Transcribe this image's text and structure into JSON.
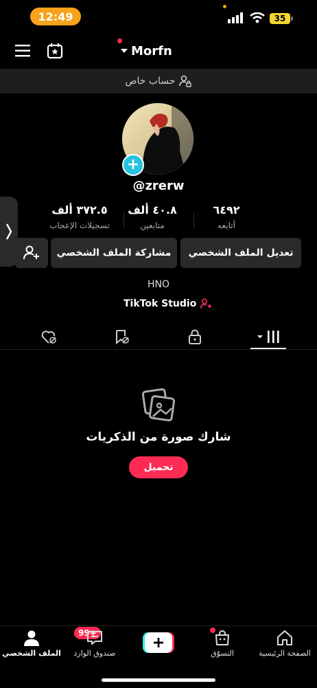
{
  "status_bar": {
    "time": "12:49",
    "battery": "35"
  },
  "header": {
    "username": "Morfn"
  },
  "private_account": {
    "label": "حساب خاص"
  },
  "profile": {
    "handle": "@zrerw",
    "bio": "HNO",
    "studio_link": "TikTok Studio"
  },
  "stats": {
    "following": {
      "value": "٦٤٩٢",
      "label": "أتابعه"
    },
    "followers": {
      "value": "٤٠.٨ ألف",
      "label": "متابعين"
    },
    "likes": {
      "value": "٣٧٢.٥ ألف",
      "label": "تسجيلات الإعجاب"
    }
  },
  "buttons": {
    "edit_profile": "تعديل الملف الشخصي",
    "share_profile": "مشاركة الملف الشخصي"
  },
  "empty_state": {
    "title": "شارك صورة من الذكريات",
    "upload_label": "تحميل"
  },
  "bottom_nav": {
    "home": "الصفحة الرئيسية",
    "shop": "التسوّق",
    "inbox": "صندوق الوارد",
    "inbox_badge": "99+",
    "profile": "الملف الشخصي"
  },
  "colors": {
    "accent": "#fe2c55",
    "time_pill": "#f7a21b",
    "cyan": "#25c3de"
  }
}
